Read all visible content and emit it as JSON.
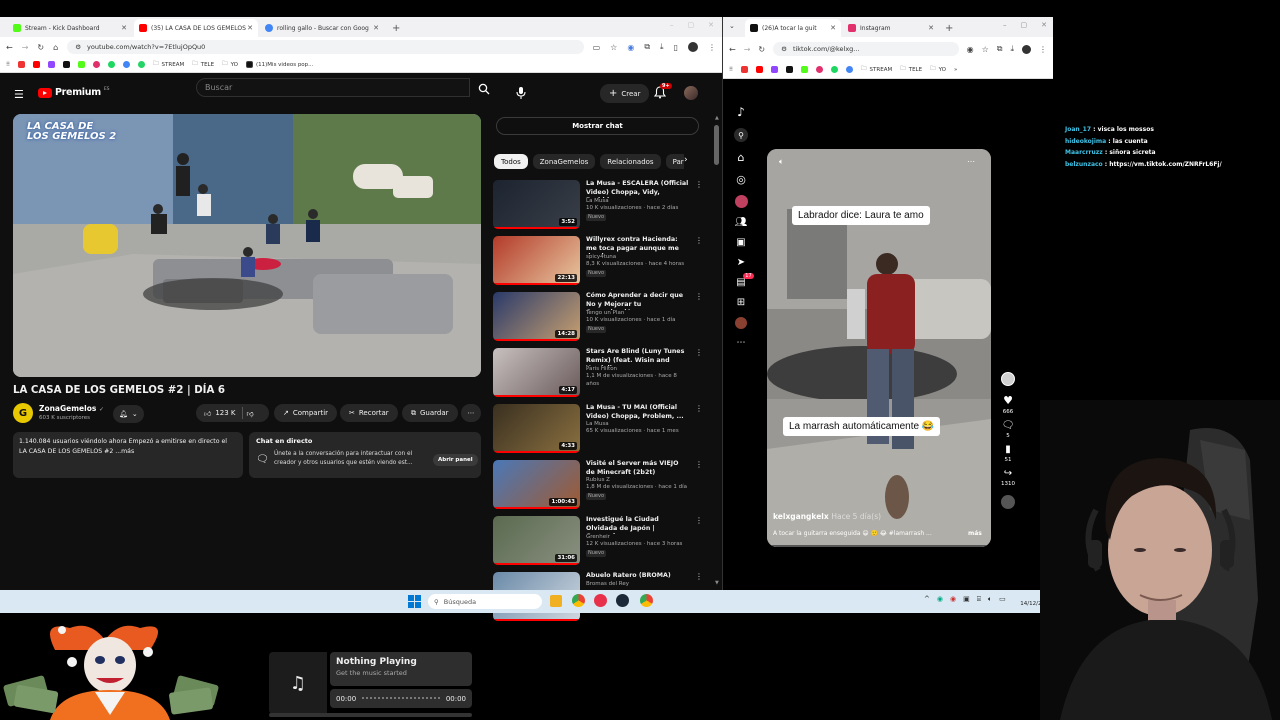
{
  "left_browser": {
    "tabs": [
      {
        "label": "Stream - Kick Dashboard",
        "color": "#53fc18"
      },
      {
        "label": "(35) LA CASA DE LOS GEMELOS",
        "color": "#ff0000"
      },
      {
        "label": "rolling gallo - Buscar con Goog",
        "color": "#4285f4"
      }
    ],
    "url": "youtube.com/watch?v=7EtlujOpQu0",
    "bookmarks": [
      "STREAM",
      "TELE",
      "YO",
      "(11)Mis videos pop..."
    ]
  },
  "youtube": {
    "logo": "Premium",
    "logo_badge": "ES",
    "search_placeholder": "Buscar",
    "create_label": "Crear",
    "notif_count": "9+",
    "video_title": "LA CASA DE LOS GEMELOS #2 | DÍA 6",
    "channel": "ZonaGemelos",
    "subscribers": "603 K suscriptores",
    "likes": "123 K",
    "share_label": "Compartir",
    "clip_label": "Recortar",
    "save_label": "Guardar",
    "description": "1.140.084 usuarios viéndolo ahora  Empezó a emitirse en directo el",
    "description2": "LA CASA DE LOS GEMELOS #2 ...más",
    "live_chat_title": "Chat en directo",
    "live_chat_text": "Únete a la conversación para interactuar con el creador y otros usuarios que estén viendo est...",
    "open_panel": "Abrir panel",
    "show_chat": "Mostrar chat",
    "video_overlay_logo": "LA CASA DE LOS GEMELOS 2",
    "chips": [
      "Todos",
      "ZonaGemelos",
      "Relacionados",
      "Para"
    ],
    "recommendations": [
      {
        "title": "La Musa - ESCALERA (Official Video) Choppa, Vidy, Probble...",
        "channel": "La Musa",
        "meta": "10 K visualizaciones · hace 2 días",
        "duration": "3:52",
        "new": "Nuevo",
        "c1": "#1c2430",
        "c2": "#3a3f48"
      },
      {
        "title": "Willyrex contra Hacienda: me toca pagar aunque me den la ...",
        "channel": "spicy4tuna",
        "meta": "8,3 K visualizaciones · hace 4 horas",
        "duration": "22:13",
        "new": "Nuevo",
        "c1": "#b33a2a",
        "c2": "#e8c8a0"
      },
      {
        "title": "Cómo Aprender a decir que No y Mejorar tu Comunicación ...",
        "channel": "Tengo un Plan",
        "meta": "10 K visualizaciones · hace 1 día",
        "duration": "14:28",
        "new": "Nuevo",
        "c1": "#2a3a6a",
        "c2": "#c8a070"
      },
      {
        "title": "Stars Are Blind (Luny Tunes Remix) (feat. Wisin and Yandel)",
        "channel": "Paris Hilton",
        "meta": "1,1 M de visualizaciones · hace 8 años",
        "duration": "4:17",
        "new": "",
        "c1": "#c8c0c0",
        "c2": "#6a5a5a"
      },
      {
        "title": "La Musa - TU MAI (Official Video) Choppa, Problem, ...",
        "channel": "La Musa",
        "meta": "65 K visualizaciones · hace 1 mes",
        "duration": "4:33",
        "new": "",
        "c1": "#3a3020",
        "c2": "#8a7040"
      },
      {
        "title": "Visité el Server más VIEJO de Minecraft (2b2t)",
        "channel": "Rubius Z",
        "meta": "1,8 M de visualizaciones · hace 1 día",
        "duration": "1:00:43",
        "new": "Nuevo",
        "c1": "#4a78b8",
        "c2": "#a05a30"
      },
      {
        "title": "Investigué la Ciudad Olvidada de Japón | Cruzando ...",
        "channel": "Grenheir",
        "meta": "12 K visualizaciones · hace 3 horas",
        "duration": "31:06",
        "new": "Nuevo",
        "c1": "#5a6a50",
        "c2": "#8a9080"
      },
      {
        "title": "Abuelo Ratero (BROMA)",
        "channel": "Bromas del Rey",
        "meta": "",
        "duration": "",
        "new": "",
        "c1": "#6a8aa8",
        "c2": "#d0d8e0"
      }
    ]
  },
  "right_browser": {
    "tabs": [
      {
        "label": "(26)A tocar la guit",
        "color": "#111111"
      },
      {
        "label": "Instagram",
        "color": "#e1306c"
      }
    ],
    "url": "tiktok.com/@kelxg...",
    "bookmarks": [
      "STREAM",
      "TELE",
      "YO"
    ]
  },
  "tiktok": {
    "caption_top": "Labrador dice: Laura te amo",
    "caption_mid": "La marrash automáticamente 😂",
    "author": "kelxgangkelx",
    "time": "Hace 5 día(s)",
    "description": "A tocar la guitarra enseguida 😄 🙂 😂 #lamarrash ...",
    "more": "más",
    "likes": "666",
    "comments": "5",
    "saves": "51",
    "shares": "1310",
    "inbox_count": "17"
  },
  "taskbar": {
    "search_placeholder": "Búsqueda",
    "time": "0:42",
    "date": "14/12/2025"
  },
  "chat": [
    {
      "user": "Joan_17",
      "msg": "visca los mossos"
    },
    {
      "user": "hideokojima",
      "msg": "las cuenta"
    },
    {
      "user": "Maarcrruzz",
      "msg": "siñora sicreta"
    },
    {
      "user": "belzunzaco",
      "msg": "https://vm.tiktok.com/ZNRFrL6Fj/"
    }
  ],
  "music": {
    "title": "Nothing Playing",
    "subtitle": "Get the music started",
    "time_start": "00:00",
    "time_end": "00:00"
  }
}
